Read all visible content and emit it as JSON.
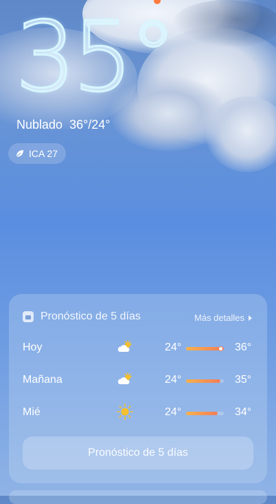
{
  "current": {
    "temperature": "35°",
    "condition": "Nublado",
    "range": "36°/24°",
    "aqi_label": "ICA 27"
  },
  "forecast": {
    "title": "Pronóstico de 5 días",
    "more_label": "Más detalles",
    "button_label": "Pronóstico de 5 días",
    "days": [
      {
        "day": "Hoy",
        "icon": "partly-cloudy-icon",
        "low": "24°",
        "high": "36°",
        "low_value": 24,
        "high_value": 36,
        "current_value": 35
      },
      {
        "day": "Mañana",
        "icon": "partly-cloudy-icon",
        "low": "24°",
        "high": "35°",
        "low_value": 24,
        "high_value": 35
      },
      {
        "day": "Mié",
        "icon": "sun-icon",
        "low": "24°",
        "high": "34°",
        "low_value": 24,
        "high_value": 34
      }
    ]
  },
  "colors": {
    "sky_top": "#5e88c8",
    "sky_bottom": "#8fb3e6",
    "bar_start": "#f8b24a",
    "bar_end": "#f47c57",
    "sun": "#f6c02c"
  }
}
